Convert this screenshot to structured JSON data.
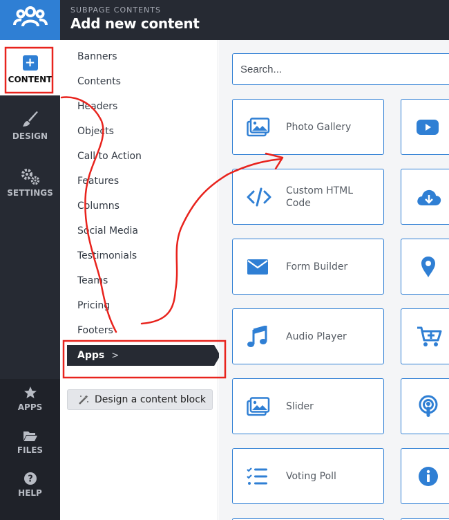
{
  "header": {
    "subtitle": "SUBPAGE CONTENTS",
    "title": "Add new content"
  },
  "rail": {
    "content": "CONTENT",
    "design": "DESIGN",
    "settings": "SETTINGS",
    "apps": "APPS",
    "files": "FILES",
    "help": "HELP"
  },
  "categories": [
    "Banners",
    "Contents",
    "Headers",
    "Objects",
    "Call to Action",
    "Features",
    "Columns",
    "Social Media",
    "Testimonials",
    "Teams",
    "Pricing",
    "Footers"
  ],
  "apps_label": "Apps",
  "apps_chevron": ">",
  "design_block_label": "Design a content block",
  "search": {
    "placeholder": "Search..."
  },
  "tiles": [
    {
      "label": "Photo Gallery",
      "icon": "photo-gallery-icon"
    },
    {
      "label": "Custom HTML Code",
      "icon": "code-icon"
    },
    {
      "label": "Form Builder",
      "icon": "envelope-icon"
    },
    {
      "label": "Audio Player",
      "icon": "music-icon"
    },
    {
      "label": "Slider",
      "icon": "image-icon"
    },
    {
      "label": "Voting Poll",
      "icon": "checklist-icon"
    }
  ],
  "right_tiles": [
    {
      "icon": "youtube-icon"
    },
    {
      "icon": "cloud-download-icon"
    },
    {
      "icon": "map-pin-icon"
    },
    {
      "icon": "cart-plus-icon"
    },
    {
      "icon": "podcast-icon"
    },
    {
      "icon": "info-icon"
    }
  ],
  "colors": {
    "accent": "#2f7fd4",
    "dark": "#262a33",
    "annotation": "#e8231d"
  }
}
